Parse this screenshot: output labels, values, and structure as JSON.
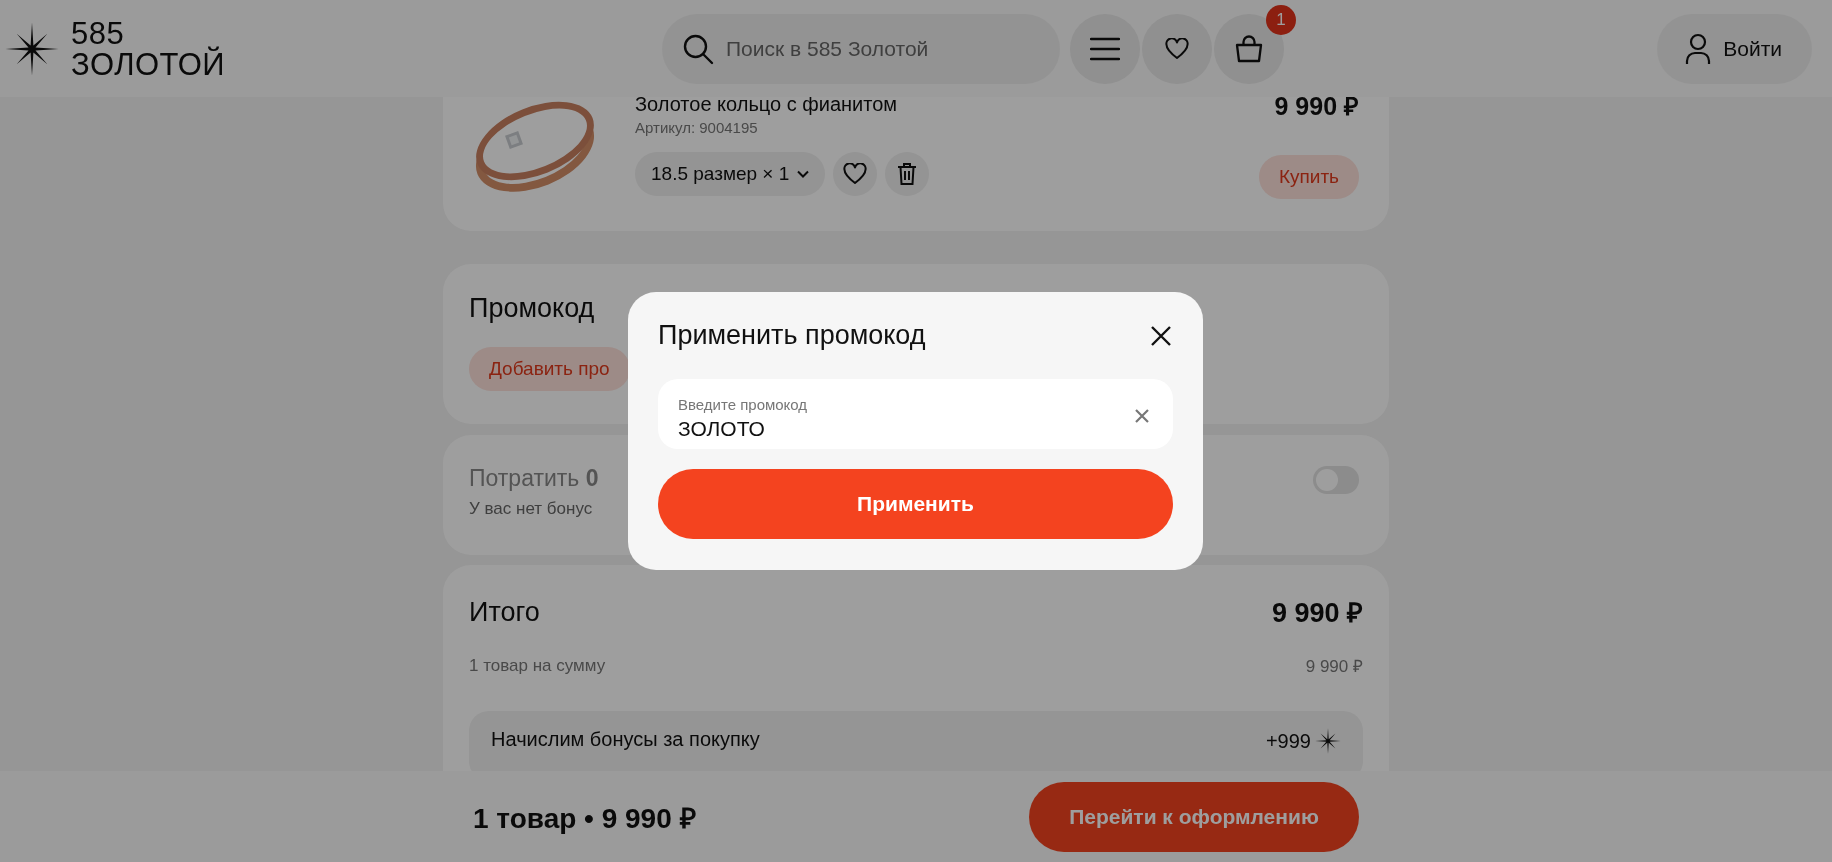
{
  "header": {
    "logo": {
      "line_1": "585",
      "line_2": "ЗОЛОТОЙ"
    },
    "search": {
      "placeholder": "Поиск в 585 Золотой"
    },
    "cart_badge": "1",
    "login_button": "Войти"
  },
  "cart_item": {
    "title": "Золотое кольцо с фианитом",
    "article": "Артикул: 9004195",
    "price": "9 990 ₽",
    "size_selector": "18.5 размер × 1",
    "favorite": false,
    "buy_button": "Купить"
  },
  "promo_section": {
    "title": "Промокод",
    "add_button": "Добавить про"
  },
  "bonus_section": {
    "text": "Потратить **0**",
    "note": "У вас нет бонус",
    "toggle_on": false
  },
  "summary": {
    "title": "Итого",
    "total": "9 990 ₽",
    "items_label": "1 товар на сумму",
    "items_sum": "9 990 ₽",
    "bonus_label": "Начислим бонусы за покупку",
    "bonus_value": "+999"
  },
  "bottom_bar": {
    "summary": "1 товар • 9 990 ₽",
    "checkout_button": "Перейти к оформлению"
  },
  "promo_dialog": {
    "title": "Применить промокод",
    "field": {
      "label": "Введите промокод",
      "value": "ЗОЛОТО"
    },
    "apply_button": "Применить"
  }
}
